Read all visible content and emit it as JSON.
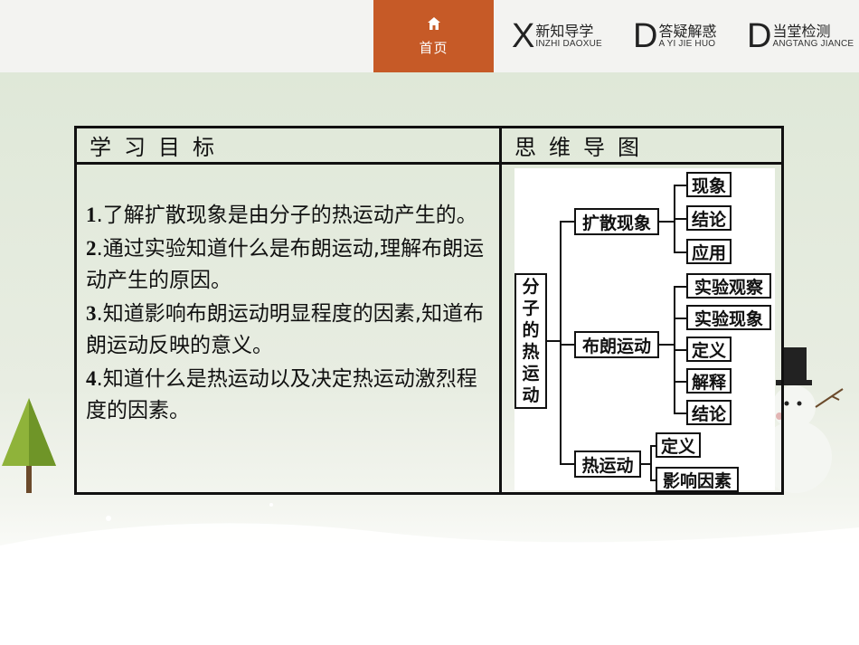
{
  "nav": {
    "home": {
      "icon": "home-icon",
      "label": "首页"
    },
    "items": [
      {
        "letter": "X",
        "zh": "新知导学",
        "en": "INZHI DAOXUE"
      },
      {
        "letter": "D",
        "zh": "答疑解惑",
        "en": "A YI JIE HUO"
      },
      {
        "letter": "D",
        "zh": "当堂检测",
        "en": "ANGTANG JIANCE"
      }
    ]
  },
  "table": {
    "left_header": "学习目标",
    "right_header": "思维导图",
    "goals": [
      {
        "num": "1",
        "text": ".了解扩散现象是由分子的热运动产生的。"
      },
      {
        "num": "2",
        "text": ".通过实验知道什么是布朗运动,理解布朗运动产生的原因。"
      },
      {
        "num": "3",
        "text": ".知道影响布朗运动明显程度的因素,知道布朗运动反映的意义。"
      },
      {
        "num": "4",
        "text": ".知道什么是热运动以及决定热运动激烈程度的因素。"
      }
    ]
  },
  "mindmap": {
    "root": [
      "分",
      "子",
      "的",
      "热",
      "运",
      "动"
    ],
    "branch1": "扩散现象",
    "branch1_leaves": [
      "现象",
      "结论",
      "应用"
    ],
    "branch2": "布朗运动",
    "branch2_leaves": [
      "实验观察",
      "实验现象",
      "定义",
      "解释",
      "结论"
    ],
    "branch3": "热运动",
    "branch3_leaves": [
      "定义",
      "影响因素"
    ]
  },
  "colors": {
    "accent": "#c65a27",
    "panel_bg": "#dfe8d8"
  }
}
